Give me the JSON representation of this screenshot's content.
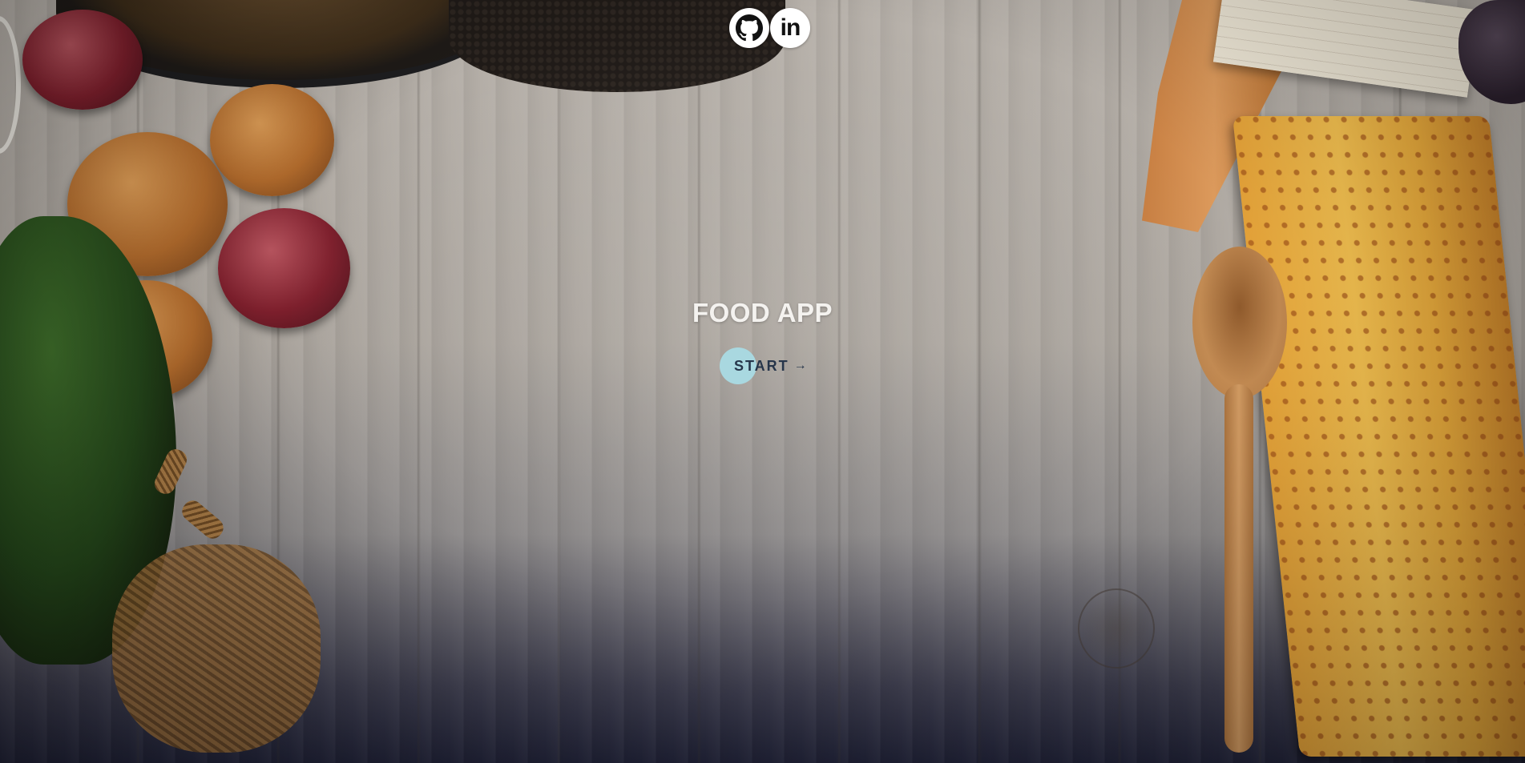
{
  "app": {
    "title": "FOOD APP"
  },
  "hero": {
    "start_label": "START",
    "start_arrow": "→"
  },
  "social": {
    "items": [
      {
        "icon": "github-icon"
      },
      {
        "icon": "linkedin-icon",
        "glyph": "in"
      }
    ]
  },
  "colors": {
    "button_accent": "#a9d8e0",
    "button_text": "#26354a",
    "title_text": "#f4f2ef",
    "icon_bg": "#ffffff"
  }
}
